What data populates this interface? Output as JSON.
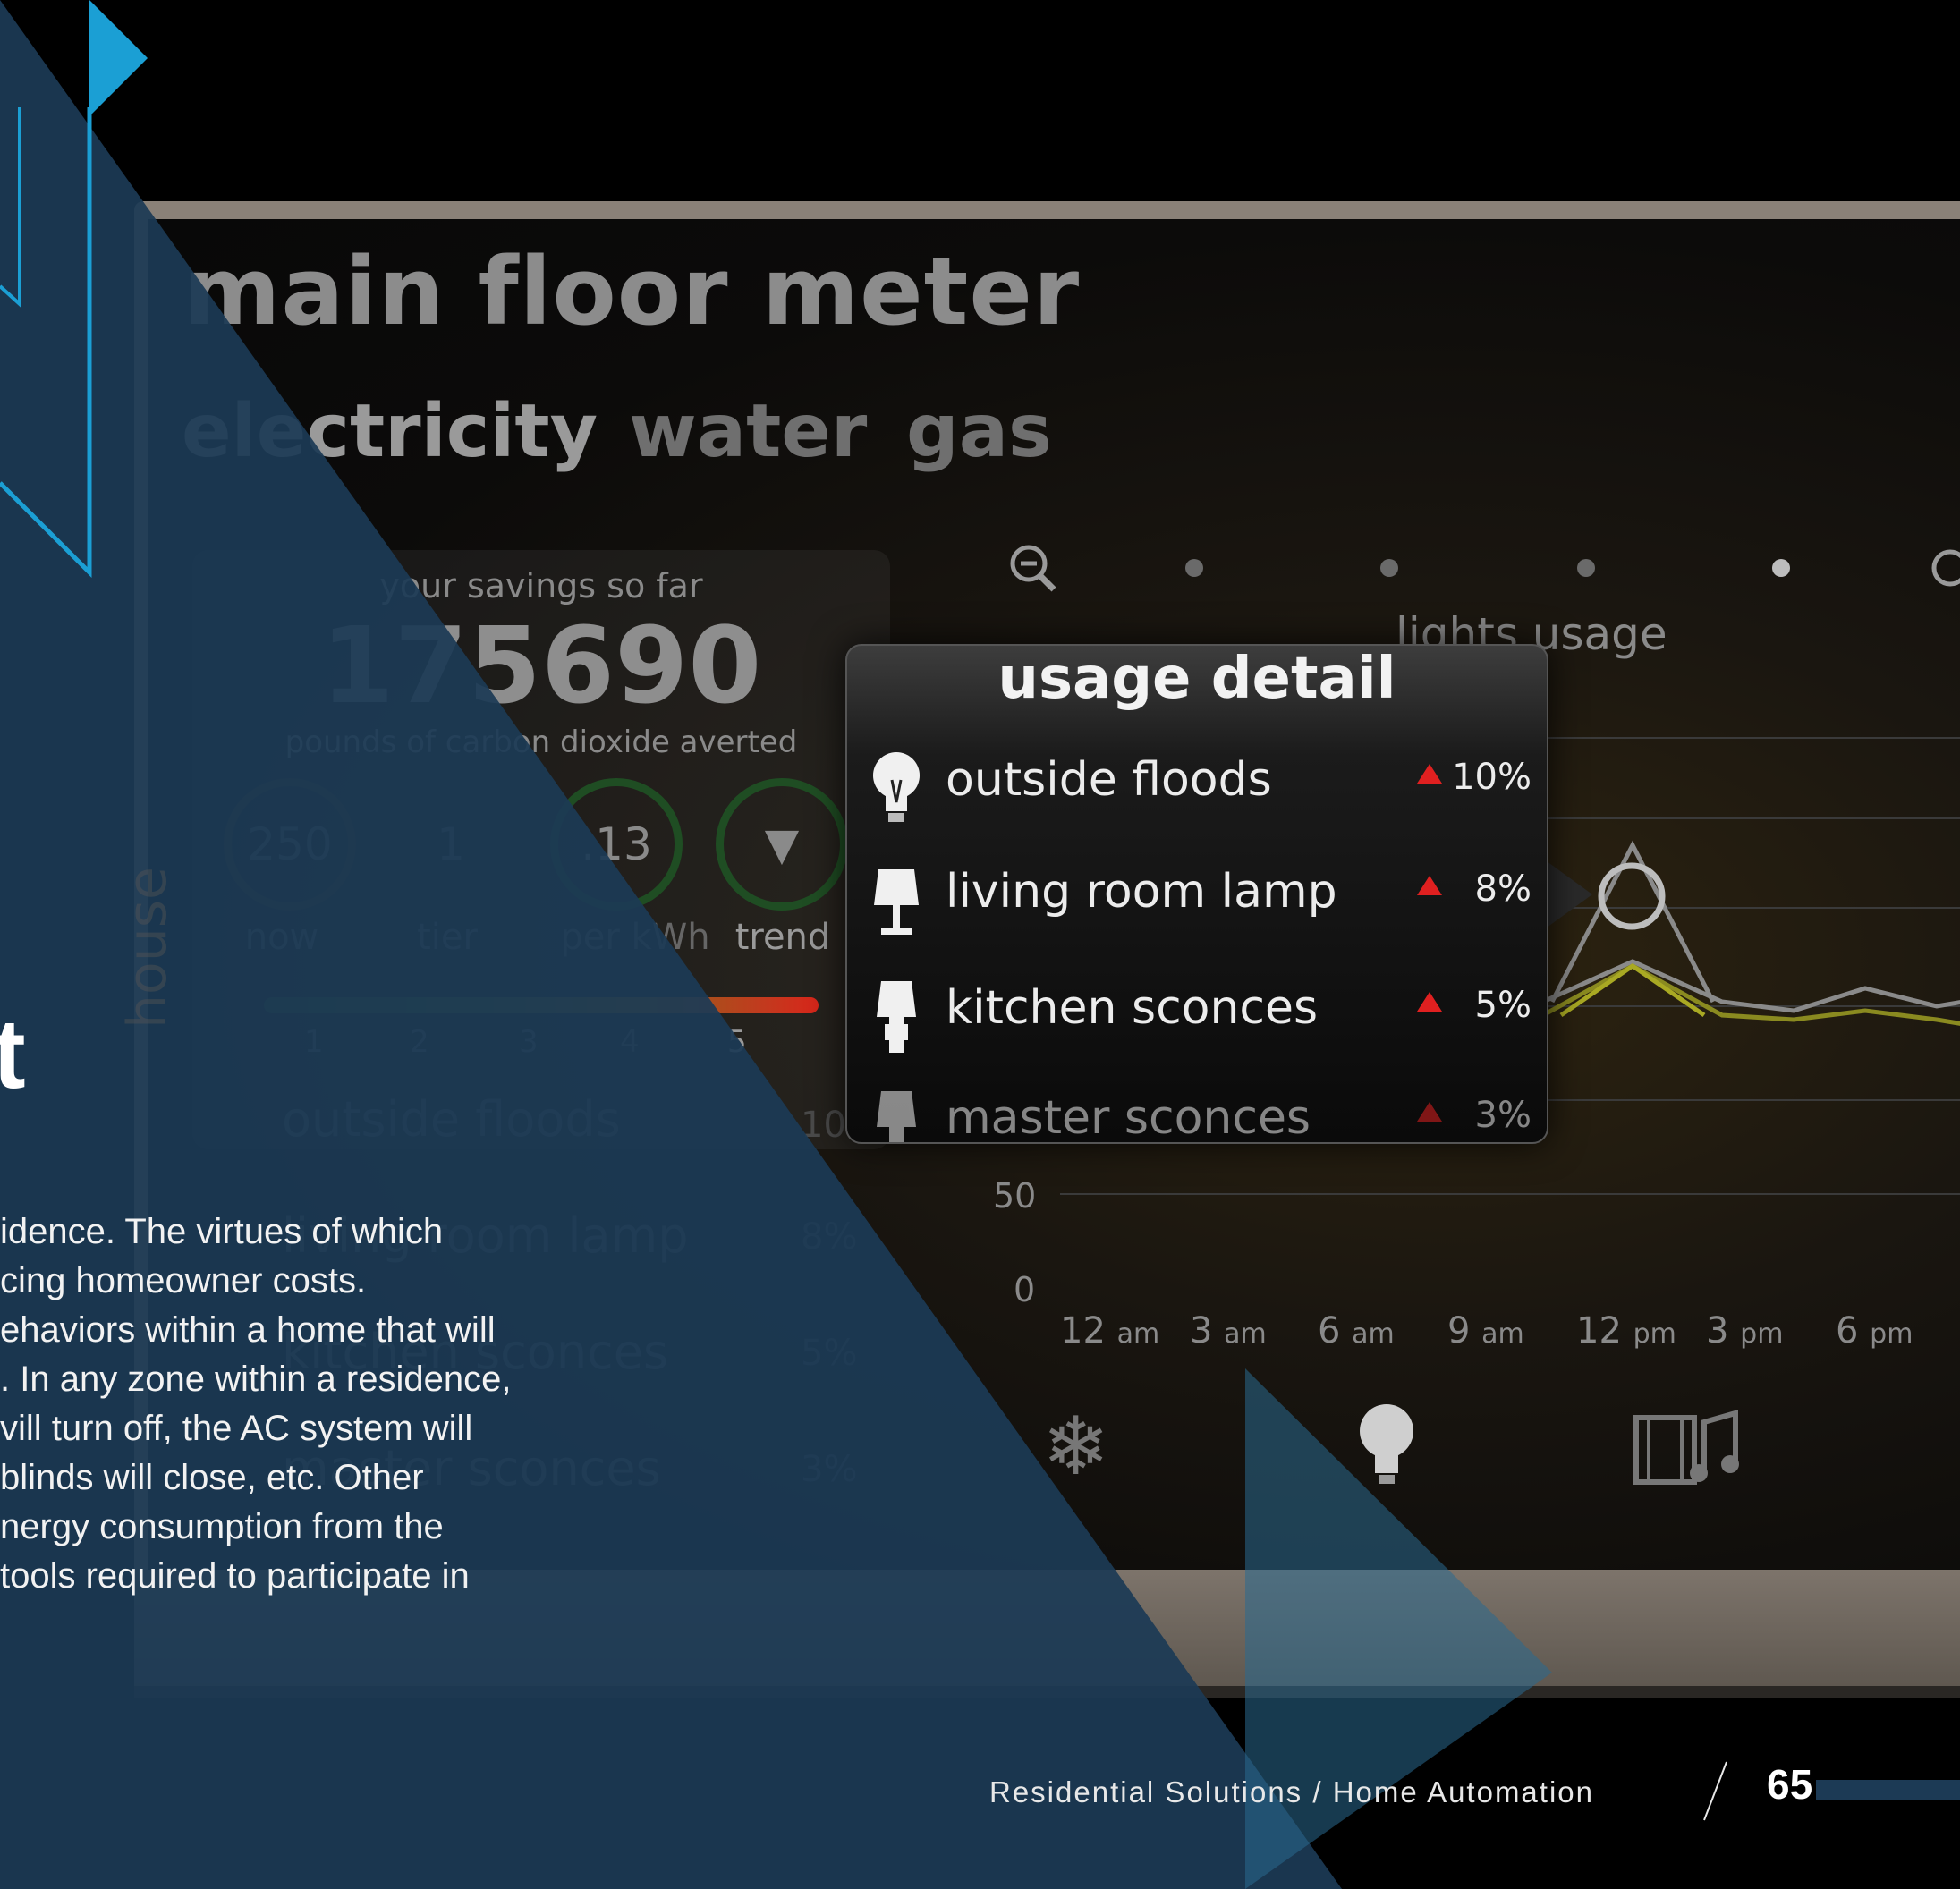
{
  "screen": {
    "title": "main floor meter",
    "tabs": [
      {
        "label": "electricity",
        "active": true
      },
      {
        "label": "water",
        "active": false
      },
      {
        "label": "gas",
        "active": false
      }
    ],
    "savings": {
      "caption": "your savings so far",
      "value": "175690",
      "unit_caption": "pounds of carbon dioxide averted",
      "stats": [
        {
          "value": "250",
          "label": "now"
        },
        {
          "value": "1",
          "label": "tier"
        },
        {
          "value": ".13",
          "label": "per kWh"
        },
        {
          "value": "▼",
          "label": "trend"
        }
      ],
      "scale": [
        "1",
        "2",
        "3",
        "4",
        "5"
      ]
    },
    "background_list": [
      {
        "label": "outside floods",
        "pct": "10%"
      },
      {
        "label": "living room lamp",
        "pct": "8%"
      },
      {
        "label": "kitchen sconces",
        "pct": "5%"
      },
      {
        "label": "master sconces",
        "pct": "3%"
      }
    ],
    "chart": {
      "title": "lights usage",
      "y_ticks": [
        "50",
        "0"
      ],
      "x_ticks": [
        {
          "num": "12",
          "unit": "am"
        },
        {
          "num": "3",
          "unit": "am"
        },
        {
          "num": "6",
          "unit": "am"
        },
        {
          "num": "9",
          "unit": "am"
        },
        {
          "num": "12",
          "unit": "pm"
        },
        {
          "num": "3",
          "unit": "pm"
        },
        {
          "num": "6",
          "unit": "pm"
        }
      ]
    },
    "popup": {
      "title": "usage detail",
      "rows": [
        {
          "label": "outside floods",
          "pct": "10%",
          "icon": "bulb-icon"
        },
        {
          "label": "living room lamp",
          "pct": "8%",
          "icon": "lamp-icon"
        },
        {
          "label": "kitchen sconces",
          "pct": "5%",
          "icon": "sconce-icon"
        },
        {
          "label": "master sconces",
          "pct": "3%",
          "icon": "sconce-icon"
        }
      ]
    },
    "bottom_icons": [
      "climate-icon",
      "lightbulb-icon",
      "media-icon"
    ]
  },
  "overlay": {
    "heading_fragment": "t",
    "side_text": "house",
    "body_lines": [
      "idence. The virtues of which",
      "cing homeowner costs.",
      "ehaviors within a home that will",
      ". In any zone within a residence,",
      "vill turn off, the AC system will",
      "blinds will close, etc. Other",
      "nergy consumption from the",
      "tools required to participate in"
    ]
  },
  "footer": {
    "text": "Residential Solutions / Home Automation",
    "page_number": "65"
  },
  "colors": {
    "overlay_blue": "#1c3a55",
    "accent_cyan": "#1b9fd4",
    "alert_red": "#e02020"
  }
}
